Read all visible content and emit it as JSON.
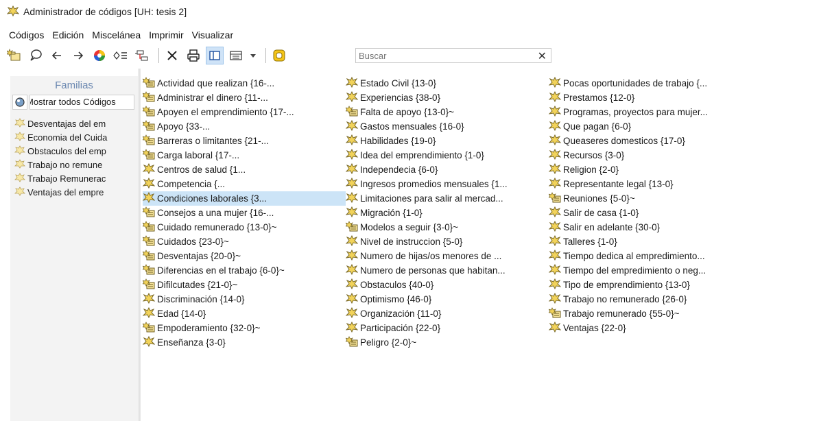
{
  "window": {
    "title": "Administrador de códigos [UH: tesis 2]"
  },
  "menu": [
    {
      "label": "Códigos"
    },
    {
      "label": "Edición"
    },
    {
      "label": "Miscelánea"
    },
    {
      "label": "Imprimir"
    },
    {
      "label": "Visualizar"
    }
  ],
  "toolbar": {
    "icons": [
      "new-code-icon",
      "comment-icon",
      "back-arrow-icon",
      "forward-arrow-icon",
      "color-wheel-icon",
      "filter-icon",
      "tree-icon",
      "delete-icon",
      "print-icon",
      "single-pane-icon",
      "list-view-icon",
      "dropdown-icon",
      "search-toggle-icon"
    ],
    "search": {
      "placeholder": "Buscar",
      "value": ""
    },
    "clear_label": "✕"
  },
  "families_panel": {
    "header": "Familias",
    "show_all_label": "Mostrar todos Códigos",
    "items": [
      {
        "label": "Desventajas del em"
      },
      {
        "label": "Economia del Cuida"
      },
      {
        "label": "Obstaculos del emp"
      },
      {
        "label": "Trabajo no remune"
      },
      {
        "label": "Trabajo Remunerac"
      },
      {
        "label": "Ventajas del empre"
      }
    ]
  },
  "codes": {
    "column1": [
      {
        "label": "Actividad que realizan {16-...",
        "icon": "code-comment-icon"
      },
      {
        "label": "Administrar el dinero {11-...",
        "icon": "code-comment-icon"
      },
      {
        "label": "Apoyen el emprendimiento {17-...",
        "icon": "code-comment-icon"
      },
      {
        "label": "Apoyo {33-...",
        "icon": "code-comment-icon"
      },
      {
        "label": "Barreras o limitantes {21-...",
        "icon": "code-comment-icon"
      },
      {
        "label": "Carga laboral {17-...",
        "icon": "code-comment-icon"
      },
      {
        "label": "Centros de salud {1...",
        "icon": "code-icon"
      },
      {
        "label": "Competencia {...",
        "icon": "code-icon"
      },
      {
        "label": "Condiciones laborales {3...",
        "icon": "code-icon",
        "selected": true
      },
      {
        "label": "Consejos a una mujer {16-...",
        "icon": "code-comment-icon"
      },
      {
        "label": "Cuidado remunerado {13-0}~",
        "icon": "code-comment-icon"
      },
      {
        "label": "Cuidados {23-0}~",
        "icon": "code-comment-icon"
      },
      {
        "label": "Desventajas {20-0}~",
        "icon": "code-comment-icon"
      },
      {
        "label": "Diferencias en el trabajo {6-0}~",
        "icon": "code-comment-icon"
      },
      {
        "label": "Difilcutades {21-0}~",
        "icon": "code-comment-icon"
      },
      {
        "label": "Discriminación {14-0}",
        "icon": "code-icon"
      },
      {
        "label": "Edad {14-0}",
        "icon": "code-icon"
      },
      {
        "label": "Empoderamiento {32-0}~",
        "icon": "code-comment-icon"
      },
      {
        "label": "Enseñanza {3-0}",
        "icon": "code-icon"
      }
    ],
    "column2": [
      {
        "label": "Estado Civil {13-0}",
        "icon": "code-icon"
      },
      {
        "label": "Experiencias {38-0}",
        "icon": "code-icon"
      },
      {
        "label": "Falta de apoyo {13-0}~",
        "icon": "code-comment-icon"
      },
      {
        "label": "Gastos mensuales {16-0}",
        "icon": "code-icon"
      },
      {
        "label": "Habilidades {19-0}",
        "icon": "code-icon"
      },
      {
        "label": "Idea del emprendimiento {1-0}",
        "icon": "code-icon"
      },
      {
        "label": "Independecia {6-0}",
        "icon": "code-icon"
      },
      {
        "label": "Ingresos promedios mensuales {1...",
        "icon": "code-icon"
      },
      {
        "label": "Limitaciones para salir al mercad...",
        "icon": "code-icon"
      },
      {
        "label": "Migración {1-0}",
        "icon": "code-icon"
      },
      {
        "label": "Modelos a seguir {3-0}~",
        "icon": "code-comment-icon"
      },
      {
        "label": "Nivel de instruccion {5-0}",
        "icon": "code-icon"
      },
      {
        "label": "Numero de hijas/os menores de ...",
        "icon": "code-icon"
      },
      {
        "label": "Numero de personas que habitan...",
        "icon": "code-icon"
      },
      {
        "label": "Obstaculos {40-0}",
        "icon": "code-icon"
      },
      {
        "label": "Optimismo {46-0}",
        "icon": "code-icon"
      },
      {
        "label": "Organización {11-0}",
        "icon": "code-icon"
      },
      {
        "label": "Participación {22-0}",
        "icon": "code-icon"
      },
      {
        "label": "Peligro {2-0}~",
        "icon": "code-comment-icon"
      }
    ],
    "column3": [
      {
        "label": "Pocas oportunidades de trabajo {...",
        "icon": "code-icon"
      },
      {
        "label": "Prestamos {12-0}",
        "icon": "code-icon"
      },
      {
        "label": "Programas, proyectos para mujer...",
        "icon": "code-icon"
      },
      {
        "label": "Que pagan {6-0}",
        "icon": "code-icon"
      },
      {
        "label": "Queaseres domesticos {17-0}",
        "icon": "code-icon"
      },
      {
        "label": "Recursos {3-0}",
        "icon": "code-icon"
      },
      {
        "label": "Religion {2-0}",
        "icon": "code-icon"
      },
      {
        "label": "Representante legal {13-0}",
        "icon": "code-icon"
      },
      {
        "label": "Reuniones {5-0}~",
        "icon": "code-comment-icon"
      },
      {
        "label": "Salir de casa {1-0}",
        "icon": "code-icon"
      },
      {
        "label": "Salir en adelante {30-0}",
        "icon": "code-icon"
      },
      {
        "label": "Talleres {1-0}",
        "icon": "code-icon"
      },
      {
        "label": "Tiempo dedica al empredimiento...",
        "icon": "code-icon"
      },
      {
        "label": "Tiempo del empredimiento o neg...",
        "icon": "code-icon"
      },
      {
        "label": "Tipo de emprendimiento {13-0}",
        "icon": "code-icon"
      },
      {
        "label": "Trabajo no remunerado {26-0}",
        "icon": "code-icon"
      },
      {
        "label": "Trabajo remunerado {55-0}~",
        "icon": "code-comment-icon"
      },
      {
        "label": "Ventajas {22-0}",
        "icon": "code-icon"
      }
    ]
  },
  "colors": {
    "code_icon_fill": "#f2d35a",
    "code_icon_stroke": "#7a6a2a",
    "selection": "#cce4f7",
    "families_header": "#6a87b0",
    "panel_bg": "#f3f3f3"
  }
}
